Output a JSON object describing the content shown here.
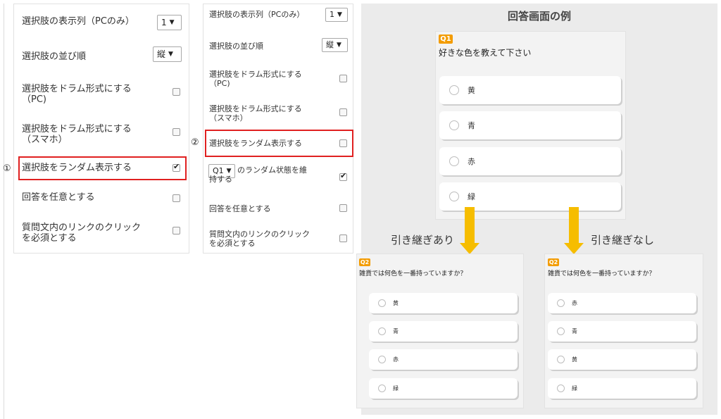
{
  "panel1": {
    "rows": [
      {
        "label": "選択肢の表示列（PCのみ）",
        "select": "1"
      },
      {
        "label": "選択肢の並び順",
        "select": "縦"
      },
      {
        "label": "選択肢をドラム形式にする\n（PC)",
        "checked": false
      },
      {
        "label": "選択肢をドラム形式にする\n（スマホ）",
        "checked": false
      },
      {
        "label": "選択肢をランダム表示する",
        "checked": true
      },
      {
        "label": "回答を任意とする",
        "checked": false
      },
      {
        "label": "質問文内のリンクのクリック\nを必須とする",
        "checked": false
      }
    ],
    "marker": "①"
  },
  "panel2": {
    "rows": [
      {
        "label": "選択肢の表示列（PCのみ）",
        "select": "1"
      },
      {
        "label": "選択肢の並び順",
        "select": "縦"
      },
      {
        "label": "選択肢をドラム形式にする\n（PC)",
        "checked": false
      },
      {
        "label": "選択肢をドラム形式にする\n（スマホ）",
        "checked": false
      },
      {
        "label": "選択肢をランダム表示する",
        "checked": false
      },
      {
        "label": "のランダム状態を維\n持する",
        "select": "Q1",
        "checked": true
      },
      {
        "label": "回答を任意とする",
        "checked": false
      },
      {
        "label": "質問文内のリンクのクリック\nを必須とする",
        "checked": false
      }
    ],
    "marker": "②"
  },
  "demo": {
    "title": "回答画面の例",
    "q1": {
      "badge": "Q1",
      "text": "好きな色を教えて下さい",
      "options": [
        "黄",
        "青",
        "赤",
        "緑"
      ]
    },
    "left_caption": "引き継ぎあり",
    "right_caption": "引き継ぎなし",
    "q2_left": {
      "badge": "Q2",
      "text": "雑貨では何色を一番持っていますか？",
      "options": [
        "黄",
        "青",
        "赤",
        "緑"
      ]
    },
    "q2_right": {
      "badge": "Q2",
      "text": "雑貨では何色を一番持っていますか？",
      "options": [
        "赤",
        "青",
        "黄",
        "緑"
      ]
    },
    "accent_color": "#f39c00",
    "arrow_color": "#f6bd00",
    "highlight_color": "#e02020"
  }
}
